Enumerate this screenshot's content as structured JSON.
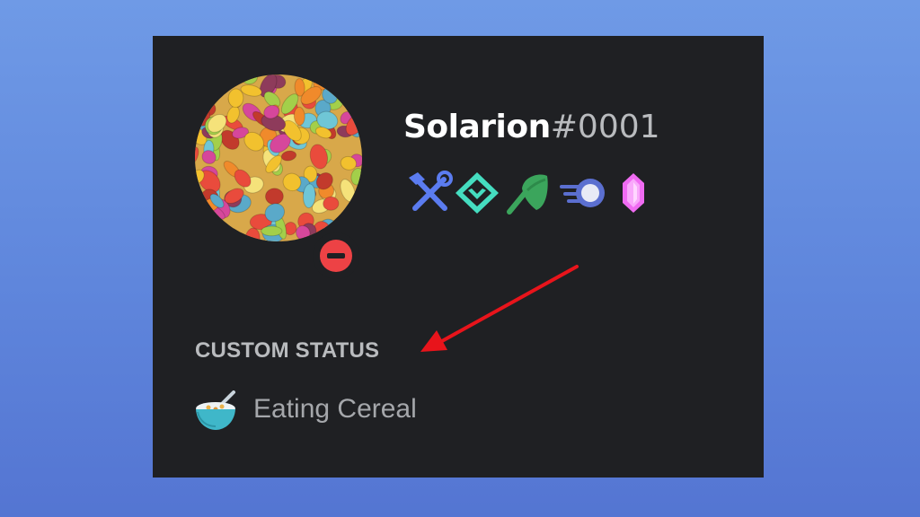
{
  "profile": {
    "username": "Solarion",
    "discriminator": "#0001",
    "avatar_icon": "cereal-avatar-image",
    "presence": "do-not-disturb",
    "presence_color": "#ed4245"
  },
  "badges": [
    {
      "name": "hammer-wrench-badge-icon",
      "color": "#5865f2"
    },
    {
      "name": "hypesquad-diamond-badge-icon",
      "color": "#45ddc0"
    },
    {
      "name": "leaf-badge-icon",
      "color": "#3ba55c"
    },
    {
      "name": "boost-orb-badge-icon",
      "color": "#7289da"
    },
    {
      "name": "nitro-gem-badge-icon",
      "color": "#ff73fa"
    }
  ],
  "custom_status": {
    "heading": "CUSTOM STATUS",
    "emoji": "bowl-of-cereal-icon",
    "text": "Eating Cereal"
  },
  "annotation": {
    "arrow_color": "#e8141b"
  }
}
